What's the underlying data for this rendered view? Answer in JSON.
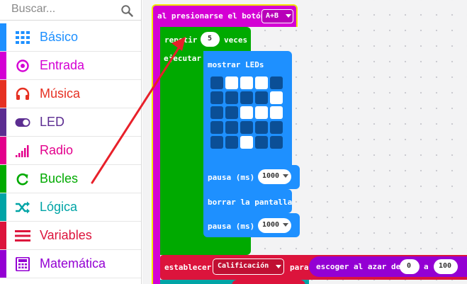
{
  "search": {
    "placeholder": "Buscar..."
  },
  "categories": [
    {
      "label": "Básico",
      "icon": "grid-icon",
      "color": "#1e90ff"
    },
    {
      "label": "Entrada",
      "icon": "target-icon",
      "color": "#d400d4"
    },
    {
      "label": "Música",
      "icon": "headphones-icon",
      "color": "#e63022"
    },
    {
      "label": "LED",
      "icon": "toggle-icon",
      "color": "#5c2d91"
    },
    {
      "label": "Radio",
      "icon": "signal-bars-icon",
      "color": "#e3008c"
    },
    {
      "label": "Bucles",
      "icon": "loop-icon",
      "color": "#00a4a6"
    },
    {
      "label": "Lógica",
      "icon": "shuffle-icon",
      "color": "#00a4a6"
    },
    {
      "label": "Variables",
      "icon": "list-icon",
      "color": "#dc143c"
    },
    {
      "label": "Matemática",
      "icon": "calculator-icon",
      "color": "#9400d3"
    }
  ],
  "blocks": {
    "event": {
      "label": "al presionarse el botón",
      "button_value": "A+B",
      "color": "#d400d4"
    },
    "repeat": {
      "label_prefix": "repetir",
      "count": "5",
      "label_suffix": "veces",
      "do_label": "ejecutar",
      "color": "#00aa00"
    },
    "show_leds": {
      "label": "mostrar LEDs",
      "color": "#1e90ff",
      "grid": [
        [
          0,
          1,
          1,
          1,
          0
        ],
        [
          0,
          0,
          0,
          0,
          1
        ],
        [
          0,
          0,
          1,
          1,
          1
        ],
        [
          0,
          0,
          0,
          0,
          0
        ],
        [
          0,
          0,
          1,
          0,
          0
        ]
      ]
    },
    "pause1": {
      "label": "pausa (ms)",
      "value": "1000"
    },
    "clear": {
      "label": "borrar la pantalla"
    },
    "pause2": {
      "label": "pausa (ms)",
      "value": "1000"
    },
    "set_var": {
      "label": "establecer",
      "variable": "Calificación",
      "to_label": "para",
      "color": "#dc143c"
    },
    "random": {
      "label": "escoger al azar de",
      "from": "0",
      "and_label": "a",
      "to": "100",
      "color": "#9400d3"
    }
  },
  "annotation": {
    "arrow_color": "#e8202a"
  }
}
